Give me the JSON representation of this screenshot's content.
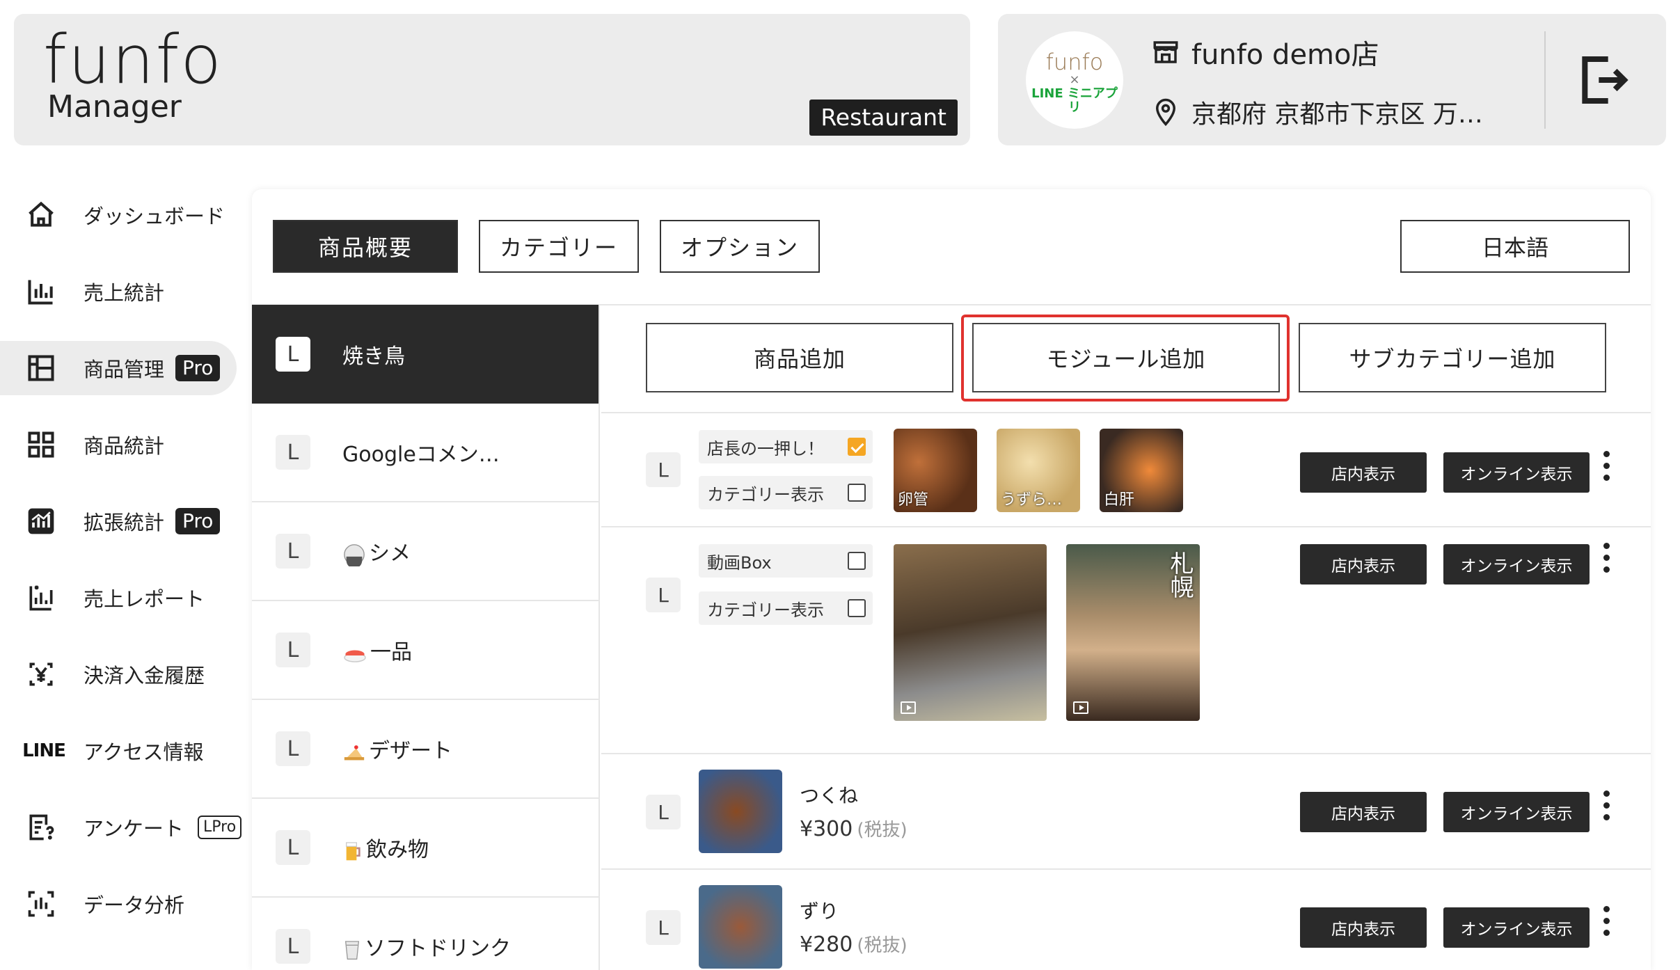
{
  "header": {
    "logo_text": "funfo",
    "logo_sub": "Manager",
    "badge": "Restaurant",
    "store_logo": {
      "brand": "funfo",
      "x": "×",
      "line": "LINE ミニアプリ"
    },
    "store_name": "funfo demo店",
    "store_address": "京都府 京都市下京区 万…"
  },
  "sidebar": {
    "items": [
      {
        "label": "ダッシュボード",
        "icon": "home-icon"
      },
      {
        "label": "売上統計",
        "icon": "bar-chart-icon"
      },
      {
        "label": "商品管理",
        "icon": "layout-icon",
        "badge": "Pro"
      },
      {
        "label": "商品統計",
        "icon": "grid-icon"
      },
      {
        "label": "拡張統計",
        "icon": "stats-box-icon",
        "badge": "Pro"
      },
      {
        "label": "売上レポート",
        "icon": "report-icon"
      },
      {
        "label": "決済入金履歴",
        "icon": "yen-icon"
      },
      {
        "label": "アクセス情報",
        "icon": "line-logo-icon",
        "logo_text": "LINE"
      },
      {
        "label": "アンケート",
        "icon": "survey-icon",
        "badge": "LPro"
      },
      {
        "label": "データ分析",
        "icon": "analysis-icon"
      }
    ]
  },
  "tabs": [
    {
      "label": "商品概要"
    },
    {
      "label": "カテゴリー"
    },
    {
      "label": "オプション"
    }
  ],
  "language": "日本語",
  "categories": [
    {
      "badge": "L",
      "label": "焼き鳥"
    },
    {
      "badge": "L",
      "label": "Googleコメン…"
    },
    {
      "badge": "L",
      "label": "シメ"
    },
    {
      "badge": "L",
      "label": "一品"
    },
    {
      "badge": "L",
      "label": "デザート"
    },
    {
      "badge": "L",
      "label": "飲み物"
    },
    {
      "badge": "L",
      "label": "ソフトドリンク"
    }
  ],
  "actions": {
    "add_product": "商品追加",
    "add_module": "モジュール追加",
    "add_subcategory": "サブカテゴリー追加"
  },
  "rows": {
    "module1": {
      "badge": "L",
      "check1_label": "店長の一押し！",
      "check2_label": "カテゴリー表示",
      "thumbs": [
        "卵管",
        "うずら…",
        "白肝"
      ]
    },
    "module2": {
      "badge": "L",
      "check1_label": "動画Box",
      "check2_label": "カテゴリー表示",
      "video_overlay": "札幌"
    },
    "product1": {
      "badge": "L",
      "name": "つくね",
      "price": "¥300",
      "tax": "(税抜)"
    },
    "product2": {
      "badge": "L",
      "name": "ずり",
      "price": "¥280",
      "tax": "(税抜)"
    },
    "btn_instore": "店内表示",
    "btn_online": "オンライン表示"
  }
}
